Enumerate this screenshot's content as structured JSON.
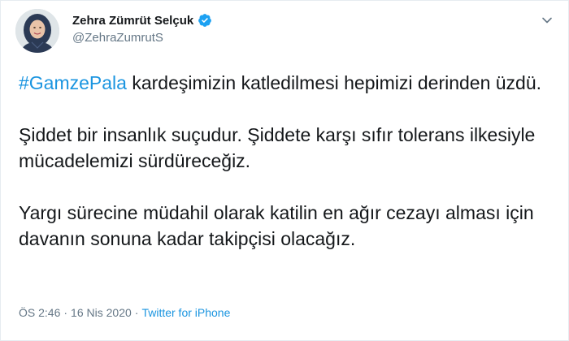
{
  "author": {
    "display_name": "Zehra Zümrüt Selçuk",
    "handle": "@ZehraZumrutS",
    "verified": true,
    "avatar_icon": "profile-photo-icon"
  },
  "tweet": {
    "hashtag": "#GamzePala",
    "paragraph_1_rest": " kardeşimizin katledilmesi hepimizi derinden üzdü.",
    "paragraph_2": "Şiddet bir insanlık suçudur. Şiddete karşı sıfır tolerans ilkesiyle mücadelemizi sürdüreceğiz.",
    "paragraph_3": "Yargı sürecine müdahil olarak katilin en ağır cezayı alması için davanın sonuna kadar takipçisi olacağız."
  },
  "meta": {
    "time": "ÖS 2:46",
    "separator": "·",
    "date": "16 Nis 2020",
    "source": "Twitter for iPhone"
  },
  "colors": {
    "link_blue": "#1b95e0",
    "muted_gray": "#657786",
    "text": "#14171a",
    "verified_blue": "#1da1f2"
  }
}
